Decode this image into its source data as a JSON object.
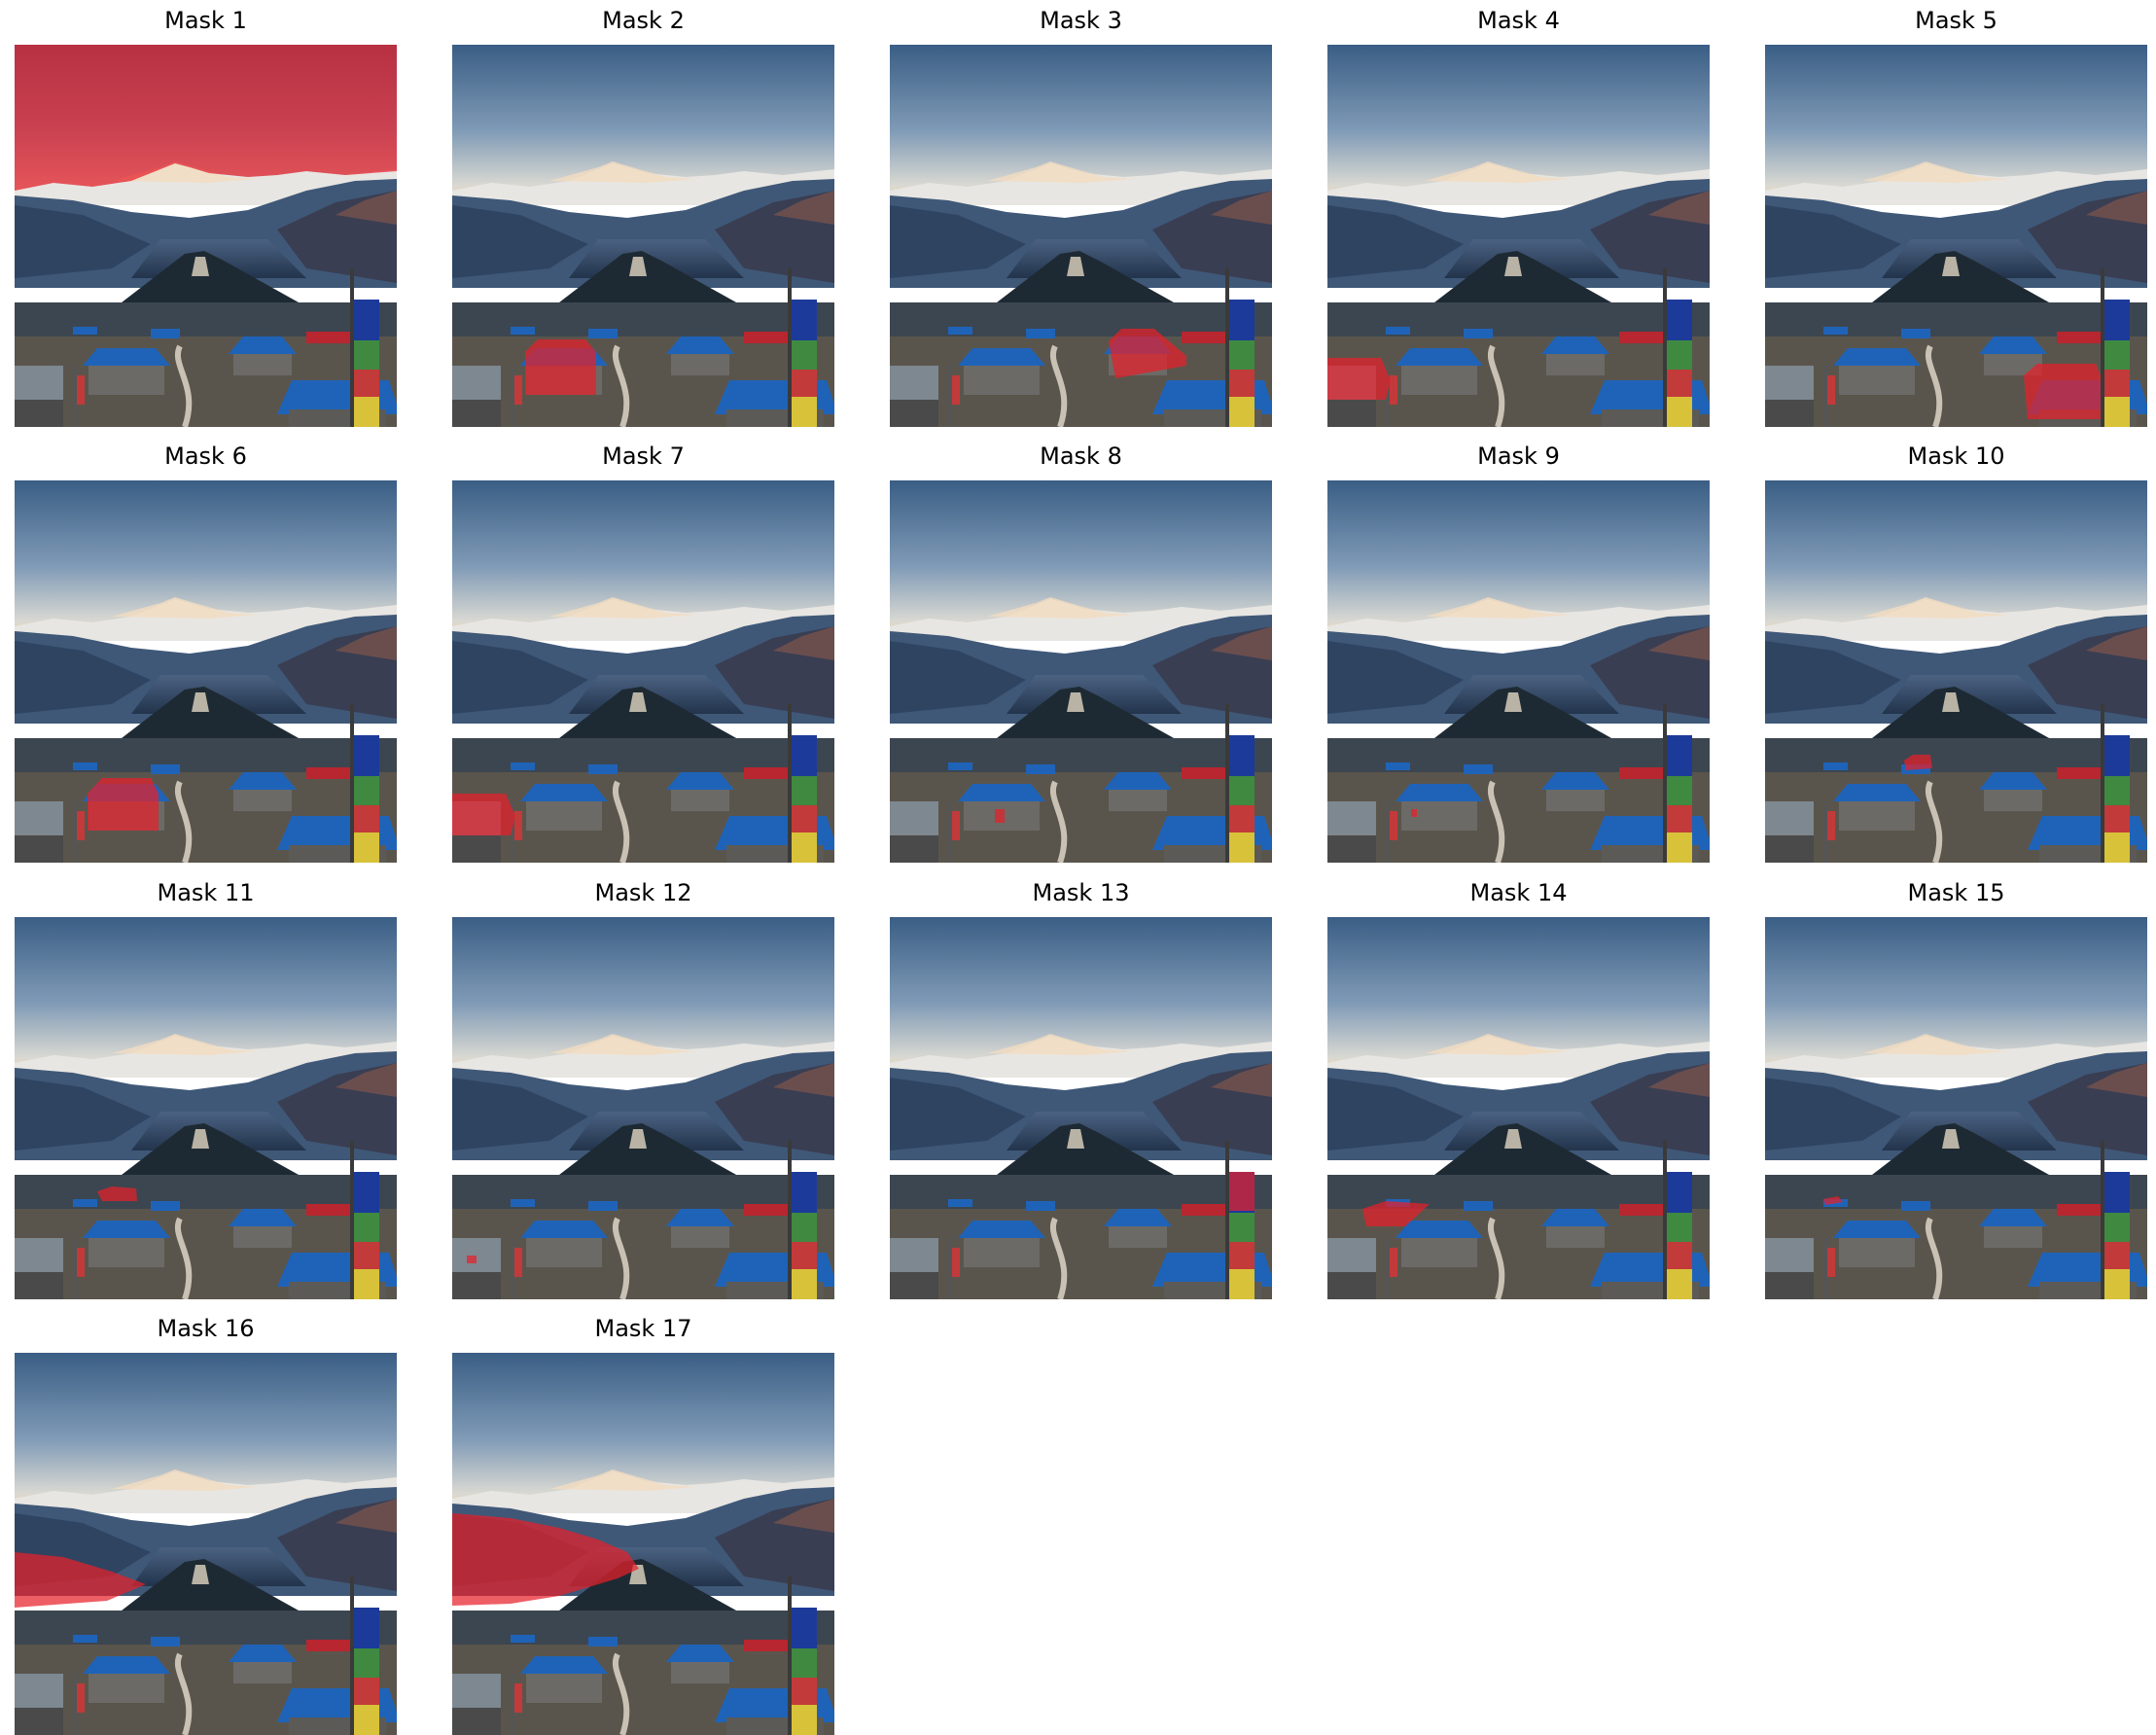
{
  "figure": {
    "panels": [
      {
        "title": "Mask 1",
        "mask": "sky"
      },
      {
        "title": "Mask 2",
        "mask": "red-house-left"
      },
      {
        "title": "Mask 3",
        "mask": "red-roof-center"
      },
      {
        "title": "Mask 4",
        "mask": "roof-left-edge"
      },
      {
        "title": "Mask 5",
        "mask": "roof-right"
      },
      {
        "title": "Mask 6",
        "mask": "red-house-left-2"
      },
      {
        "title": "Mask 7",
        "mask": "roof-left-edge-2"
      },
      {
        "title": "Mask 8",
        "mask": "window-small"
      },
      {
        "title": "Mask 9",
        "mask": "window-tiny"
      },
      {
        "title": "Mask 10",
        "mask": "small-red-roof"
      },
      {
        "title": "Mask 11",
        "mask": "roof-left-mid"
      },
      {
        "title": "Mask 12",
        "mask": "tiny-left"
      },
      {
        "title": "Mask 13",
        "mask": "flag-red"
      },
      {
        "title": "Mask 14",
        "mask": "red-roof-left-mid"
      },
      {
        "title": "Mask 15",
        "mask": "tiny-red"
      },
      {
        "title": "Mask 16",
        "mask": "hill-left"
      },
      {
        "title": "Mask 17",
        "mask": "hill-left-big"
      }
    ],
    "colors": {
      "mask_overlay": "#e8202a",
      "sky_top": "#3a5f86",
      "sky_bottom": "#e3e6e6",
      "roof_blue": "#1f63b8",
      "roof_red": "#b8262f"
    }
  }
}
